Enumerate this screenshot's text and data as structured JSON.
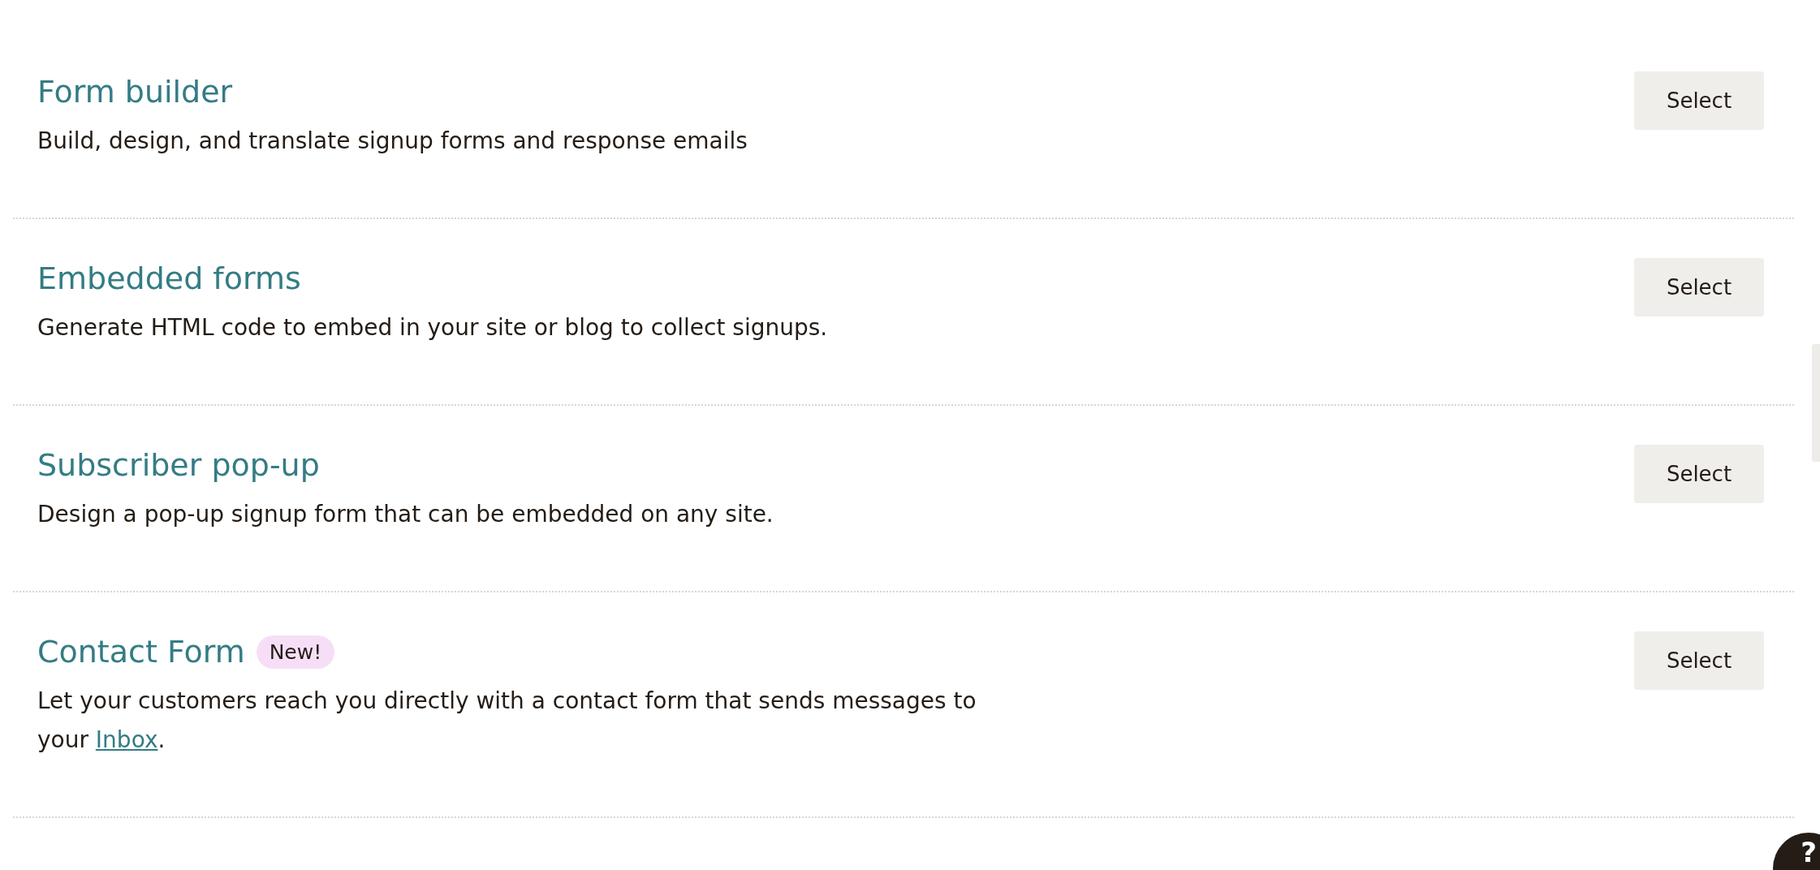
{
  "rows": [
    {
      "title": "Form builder",
      "description": [
        {
          "kind": "text",
          "text": "Build, design, and translate signup forms and response emails"
        }
      ],
      "button": "Select"
    },
    {
      "title": "Embedded forms",
      "description": [
        {
          "kind": "text",
          "text": "Generate HTML code to embed in your site or blog to collect signups."
        }
      ],
      "button": "Select"
    },
    {
      "title": "Subscriber pop-up",
      "description": [
        {
          "kind": "text",
          "text": "Design a pop-up signup form that can be embedded on any site."
        }
      ],
      "button": "Select"
    },
    {
      "title": "Contact Form",
      "badge": "New!",
      "description": [
        {
          "kind": "text",
          "text": "Let your customers reach you directly with a contact form that sends messages to your "
        },
        {
          "kind": "link",
          "text": "Inbox"
        },
        {
          "kind": "text",
          "text": "."
        }
      ],
      "button": "Select"
    }
  ],
  "help_button": {
    "label": "?"
  }
}
